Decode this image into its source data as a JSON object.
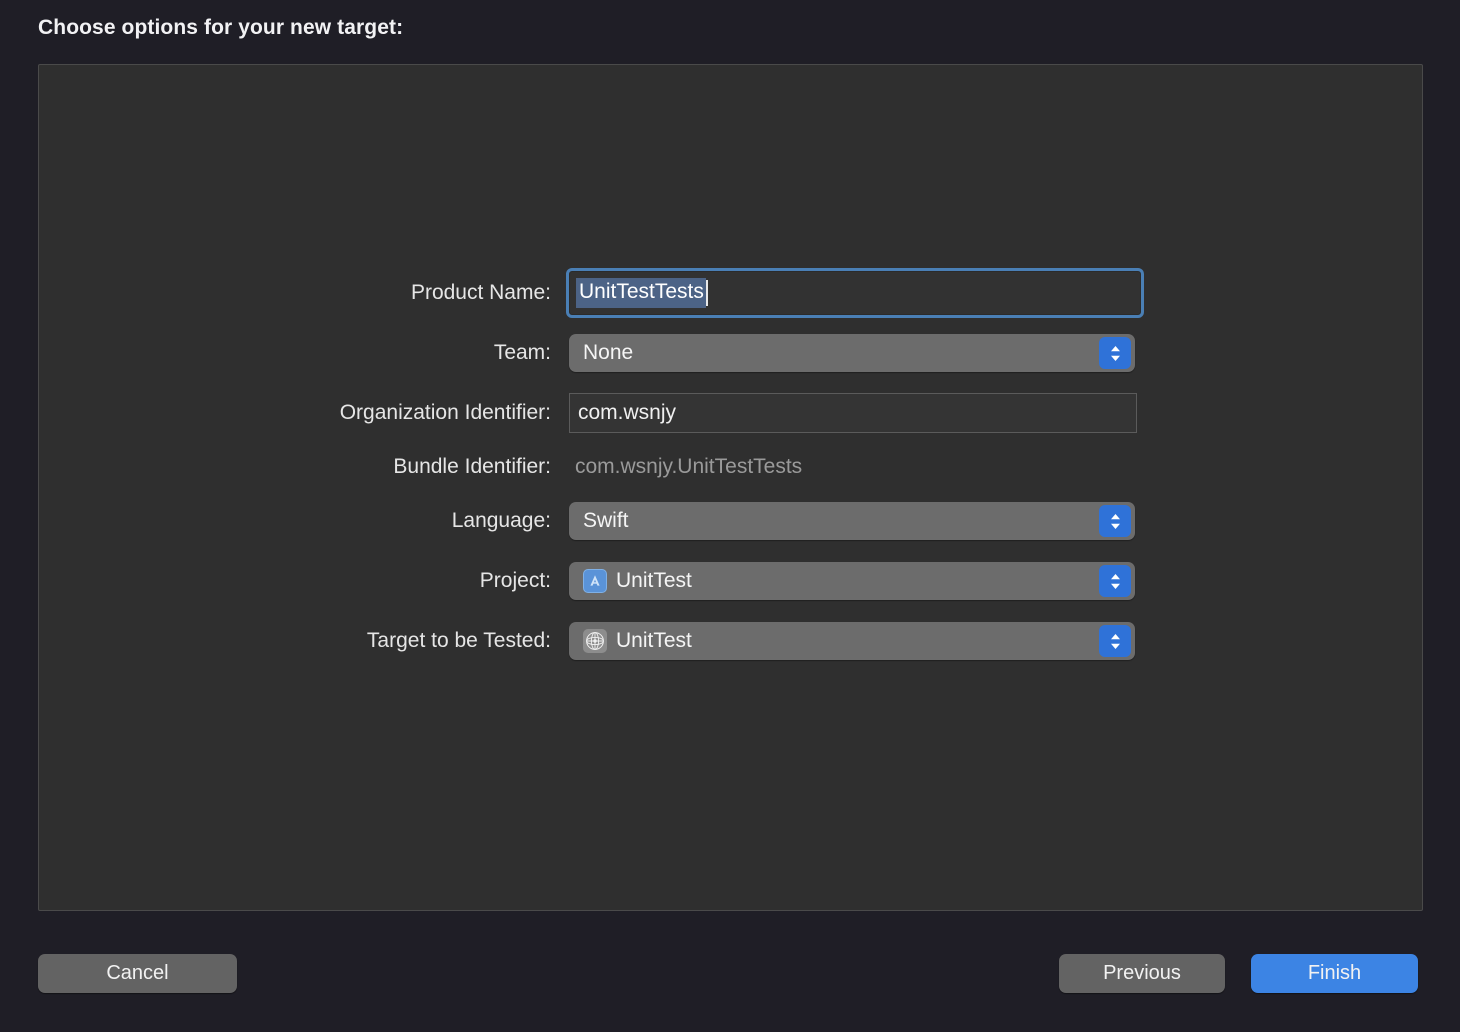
{
  "dialog": {
    "title": "Choose options for your new target:"
  },
  "form": {
    "fields": [
      {
        "label": "Product Name:",
        "type": "textfield-focused",
        "value": "UnitTestTests",
        "selected": true
      },
      {
        "label": "Team:",
        "type": "popup",
        "value": "None",
        "icon": ""
      },
      {
        "label": "Organization Identifier:",
        "type": "textfield",
        "value": "com.wsnjy"
      },
      {
        "label": "Bundle Identifier:",
        "type": "static",
        "value": "com.wsnjy.UnitTestTests"
      },
      {
        "label": "Language:",
        "type": "popup",
        "value": "Swift",
        "icon": ""
      },
      {
        "label": "Project:",
        "type": "popup",
        "value": "UnitTest",
        "icon": "xcode-project-icon"
      },
      {
        "label": "Target to be Tested:",
        "type": "popup",
        "value": "UnitTest",
        "icon": "xcode-target-icon"
      }
    ]
  },
  "footer": {
    "cancel_label": "Cancel",
    "previous_label": "Previous",
    "finish_label": "Finish"
  },
  "colors": {
    "window_background": "#1f1e26",
    "panel_background": "#2f2f2f",
    "panel_border": "#4a4a4a",
    "popup_background": "#6c6c6c",
    "stepper_blue": "#2f72d8",
    "focus_ring": "#4a7fb5",
    "selection_blue": "#4c6386",
    "finish_blue": "#3c84e4",
    "button_gray": "#636363",
    "label_text": "#e6e6e6",
    "static_text": "#9a9a9a"
  }
}
